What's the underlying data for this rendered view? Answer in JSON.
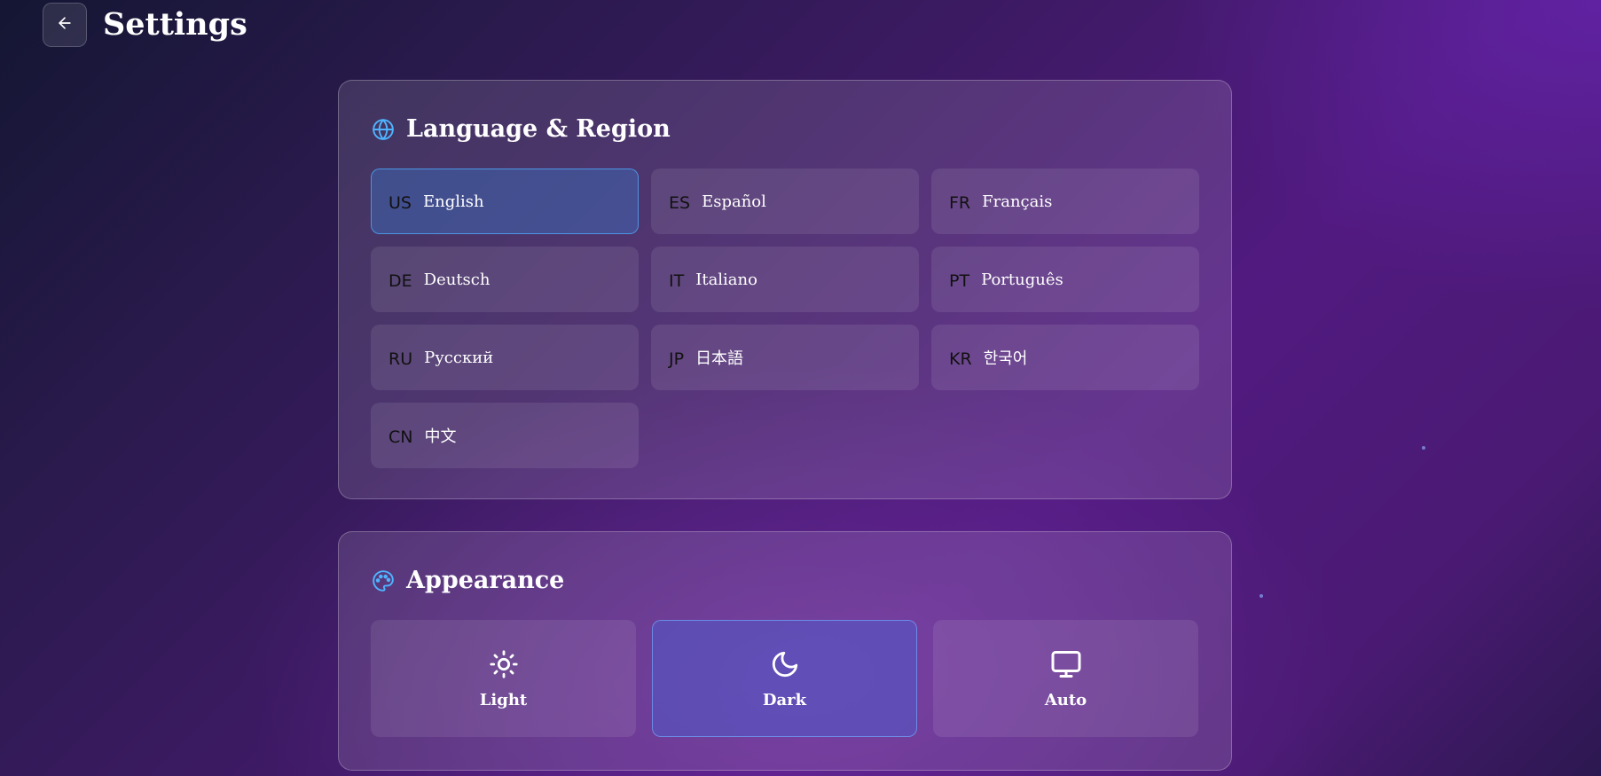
{
  "header": {
    "title": "Settings",
    "back_icon": "arrow-left-icon"
  },
  "language_region": {
    "title": "Language & Region",
    "icon": "globe-icon",
    "accent_color": "#4fb3ff",
    "selected": "English",
    "languages": [
      {
        "code": "US",
        "name": "English",
        "selected": true
      },
      {
        "code": "ES",
        "name": "Español",
        "selected": false
      },
      {
        "code": "FR",
        "name": "Français",
        "selected": false
      },
      {
        "code": "DE",
        "name": "Deutsch",
        "selected": false
      },
      {
        "code": "IT",
        "name": "Italiano",
        "selected": false
      },
      {
        "code": "PT",
        "name": "Português",
        "selected": false
      },
      {
        "code": "RU",
        "name": "Русский",
        "selected": false
      },
      {
        "code": "JP",
        "name": "日本語",
        "selected": false
      },
      {
        "code": "KR",
        "name": "한국어",
        "selected": false
      },
      {
        "code": "CN",
        "name": "中文",
        "selected": false
      }
    ]
  },
  "appearance": {
    "title": "Appearance",
    "icon": "palette-icon",
    "selected": "Dark",
    "themes": [
      {
        "label": "Light",
        "icon": "sun-icon",
        "selected": false
      },
      {
        "label": "Dark",
        "icon": "moon-icon",
        "selected": true
      },
      {
        "label": "Auto",
        "icon": "monitor-icon",
        "selected": false
      }
    ]
  }
}
